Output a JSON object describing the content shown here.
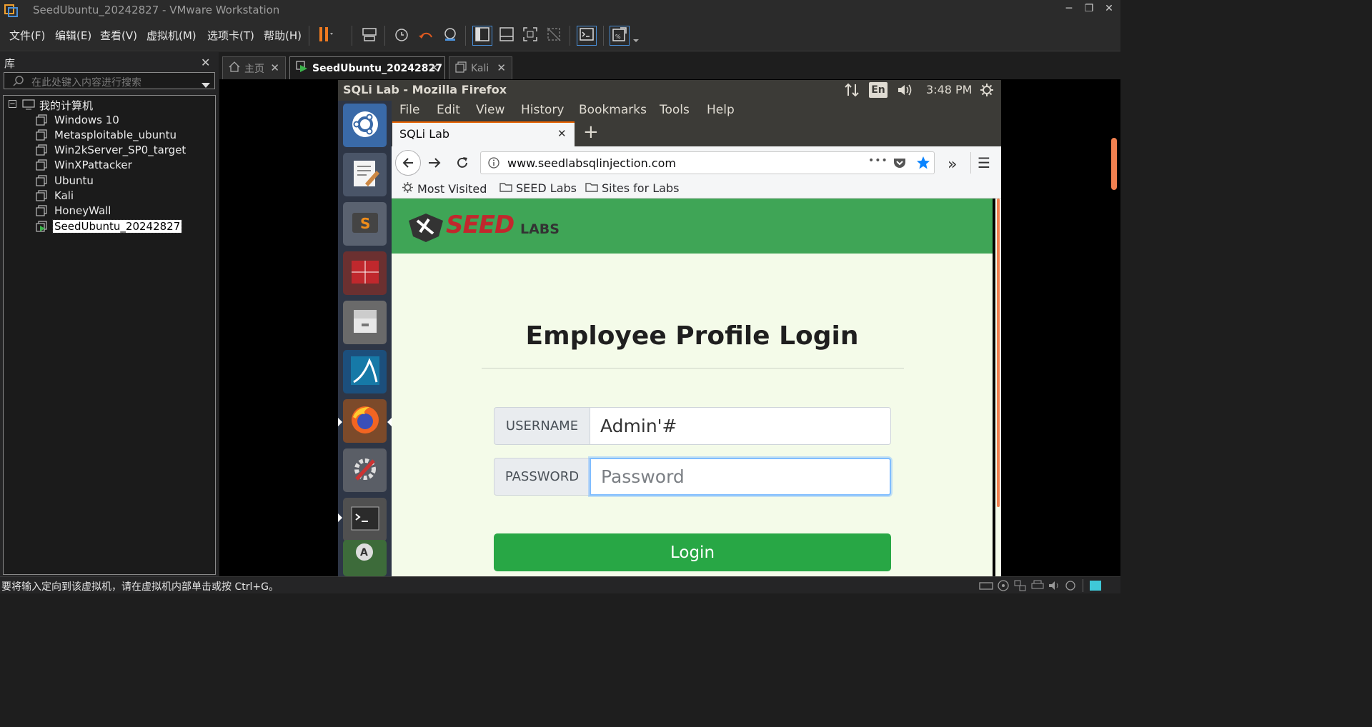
{
  "window": {
    "title": "SeedUbuntu_20242827 - VMware Workstation",
    "minimize_glyph": "─",
    "restore_glyph": "❐",
    "close_glyph": "✕"
  },
  "menubar": {
    "items": [
      "文件(F)",
      "编辑(E)",
      "查看(V)",
      "虚拟机(M)",
      "选项卡(T)",
      "帮助(H)"
    ]
  },
  "library": {
    "header": "库",
    "close_glyph": "✕",
    "search_placeholder": "在此处键入内容进行搜索",
    "root_label": "我的计算机",
    "expander": "−",
    "vms": [
      "Windows 10",
      "Metasploitable_ubuntu",
      "Win2kServer_SP0_target",
      "WinXPattacker",
      "Ubuntu",
      "Kali",
      "HoneyWall",
      "SeedUbuntu_20242827"
    ],
    "selected_vm": "SeedUbuntu_20242827"
  },
  "tabs": [
    {
      "label": "主页",
      "active": false
    },
    {
      "label": "SeedUbuntu_20242827",
      "active": true
    },
    {
      "label": "Kali",
      "active": false
    }
  ],
  "tab_close_glyph": "✕",
  "ubuntu": {
    "window_title": "SQLi Lab - Mozilla Firefox",
    "keyboard": "En",
    "clock": "3:48 PM"
  },
  "firefox": {
    "menu": [
      "File",
      "Edit",
      "View",
      "History",
      "Bookmarks",
      "Tools",
      "Help"
    ],
    "tab_title": "SQLi Lab",
    "tab_close_glyph": "✕",
    "new_tab_glyph": "+",
    "url": "www.seedlabsqlinjection.com",
    "page_actions_glyph": "•••",
    "overflow_glyph": "»",
    "menu_glyph": "☰",
    "bookmarks": [
      "Most Visited",
      "SEED Labs",
      "Sites for Labs"
    ]
  },
  "page": {
    "logo_text_seed": "SEED",
    "logo_text_labs": "LABS",
    "title": "Employee Profile Login",
    "username_label": "USERNAME",
    "username_value": "Admin'#",
    "password_label": "PASSWORD",
    "password_placeholder": "Password",
    "login_button": "Login"
  },
  "statusbar": {
    "message": "要将输入定向到该虚拟机，请在虚拟机内部单击或按 Ctrl+G。"
  },
  "colors": {
    "seed_green": "#3fa556",
    "login_green": "#28a745",
    "page_bg": "#f4fbe9",
    "firefox_accent": "#e66000",
    "vmware_accent": "#f0a030"
  }
}
